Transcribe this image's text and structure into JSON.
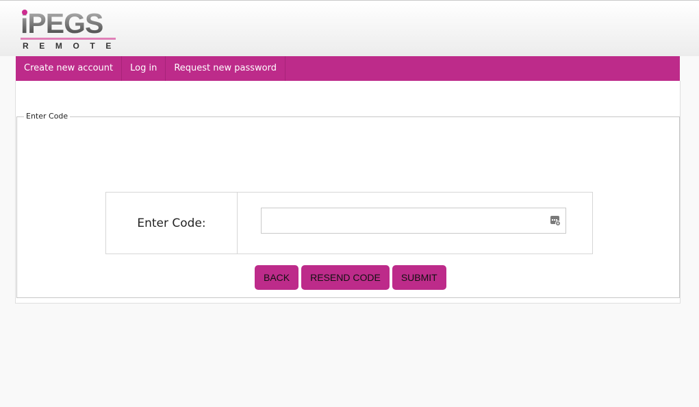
{
  "logo": {
    "top": "iPEGS",
    "bottom": "REMOTE"
  },
  "nav": [
    {
      "label": "Create new account"
    },
    {
      "label": "Log in"
    },
    {
      "label": "Request new password"
    }
  ],
  "form": {
    "legend": "Enter Code",
    "code_label": "Enter Code:",
    "code_value": "",
    "code_placeholder": ""
  },
  "buttons": {
    "back": "BACK",
    "resend": "RESEND CODE",
    "submit": "SUBMIT"
  },
  "colors": {
    "brand": "#bd2b8a",
    "nav_text": "#ffffff"
  },
  "icons": {
    "input_icon": "password-manager-key-icon"
  }
}
